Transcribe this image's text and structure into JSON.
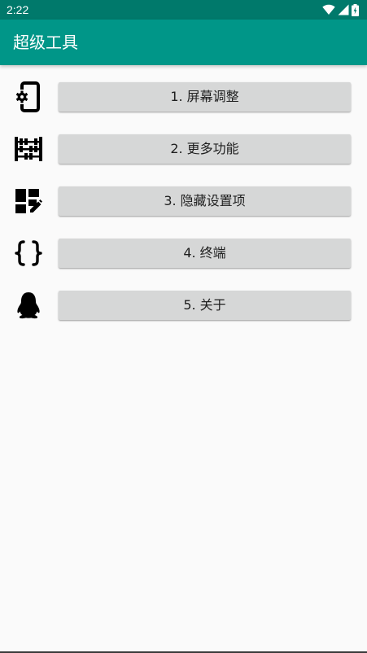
{
  "status_bar": {
    "time": "2:22",
    "background": "#00796b",
    "icons": [
      "wifi-icon",
      "signal-icon",
      "battery-icon"
    ]
  },
  "app_bar": {
    "title": "超级工具",
    "background": "#009688"
  },
  "menu": {
    "items": [
      {
        "label": "1. 屏幕调整",
        "icon": "phone-settings-icon"
      },
      {
        "label": "2. 更多功能",
        "icon": "abacus-icon"
      },
      {
        "label": "3. 隐藏设置项",
        "icon": "dashboard-edit-icon"
      },
      {
        "label": "4. 终端",
        "icon": "code-braces-icon"
      },
      {
        "label": "5. 关于",
        "icon": "qq-penguin-icon"
      }
    ]
  },
  "colors": {
    "page_background": "#fafafa",
    "button_background": "#d6d7d7",
    "icon_color": "#000000"
  }
}
